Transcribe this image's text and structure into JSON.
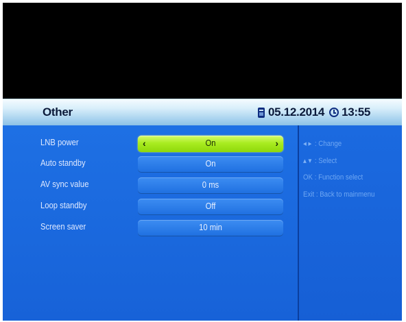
{
  "header": {
    "title": "Other",
    "date": "05.12.2014",
    "time": "13:55"
  },
  "settings": [
    {
      "label": "LNB power",
      "value": "On",
      "selected": true
    },
    {
      "label": "Auto standby",
      "value": "On",
      "selected": false
    },
    {
      "label": "AV sync value",
      "value": "0 ms",
      "selected": false
    },
    {
      "label": "Loop standby",
      "value": "Off",
      "selected": false
    },
    {
      "label": "Screen saver",
      "value": "10 min",
      "selected": false
    }
  ],
  "help": [
    {
      "key": "◂ ▸",
      "text": ": Change"
    },
    {
      "key": "▴ ▾",
      "text": ": Select"
    },
    {
      "key": "OK",
      "text": ": Function select"
    },
    {
      "key": "Exit",
      "text": ": Back to mainmenu"
    }
  ],
  "icons": {
    "calendar": "calendar-icon",
    "clock": "clock-icon",
    "left_arrow": "‹",
    "right_arrow": "›"
  },
  "colors": {
    "selected": "#a9ec21",
    "panel": "#1e70e4",
    "header": "#a9d3ef"
  }
}
